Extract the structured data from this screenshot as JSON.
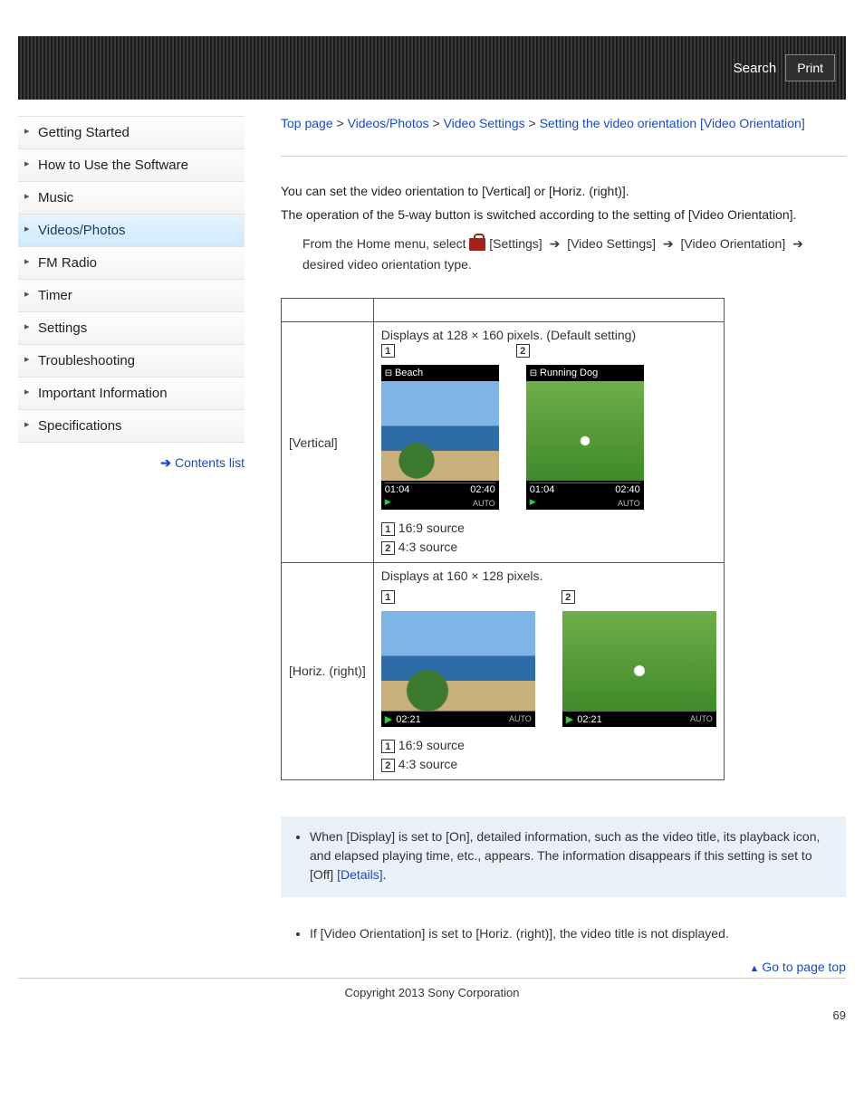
{
  "header": {
    "search_label": "Search",
    "print_label": "Print"
  },
  "sidebar": {
    "items": [
      {
        "label": "Getting Started"
      },
      {
        "label": "How to Use the Software"
      },
      {
        "label": "Music"
      },
      {
        "label": "Videos/Photos",
        "current": true
      },
      {
        "label": "FM Radio"
      },
      {
        "label": "Timer"
      },
      {
        "label": "Settings"
      },
      {
        "label": "Troubleshooting"
      },
      {
        "label": "Important Information"
      },
      {
        "label": "Specifications"
      }
    ],
    "contents_list_label": "Contents list"
  },
  "breadcrumb": {
    "top": "Top page",
    "sec1": "Videos/Photos",
    "sec2": "Video Settings",
    "title": "Setting the video orientation [Video Orientation]",
    "sep": ">"
  },
  "intro": {
    "p1": "You can set the video orientation to [Vertical] or [Horiz. (right)].",
    "p2": "The operation of the 5-way button is switched according to the setting of [Video Orientation].",
    "step_pre": "From the Home menu, select ",
    "step_settings": "[Settings]",
    "step_video_settings": "[Video Settings]",
    "step_video_orientation": "[Video Orientation]",
    "step_tail": "desired video orientation type."
  },
  "table": {
    "row1_label": "[Vertical]",
    "row1_desc": "Displays at 128 × 160 pixels. (Default setting)",
    "row2_label": "[Horiz. (right)]",
    "row2_desc": "Displays at 160 × 128 pixels.",
    "shot_beach_title": "Beach",
    "shot_dog_title": "Running Dog",
    "time_elapsed": "01:04",
    "time_total": "02:40",
    "time_elapsed_h": "02:21",
    "footer_auto": "AUTO",
    "legend1": "16:9 source",
    "legend2": "4:3 source",
    "n1": "1",
    "n2": "2"
  },
  "hint": {
    "text_a": "When [Display] is set to [On], detailed information, such as the video title, its playback icon, and elapsed playing time, etc., appears. The information disappears if this setting is set to [Off] ",
    "details": "[Details]",
    "text_b": "."
  },
  "note": {
    "text": "If [Video Orientation] is set to [Horiz. (right)], the video title is not displayed."
  },
  "gotop": "Go to page top",
  "copyright": "Copyright 2013 Sony Corporation",
  "page_number": "69"
}
